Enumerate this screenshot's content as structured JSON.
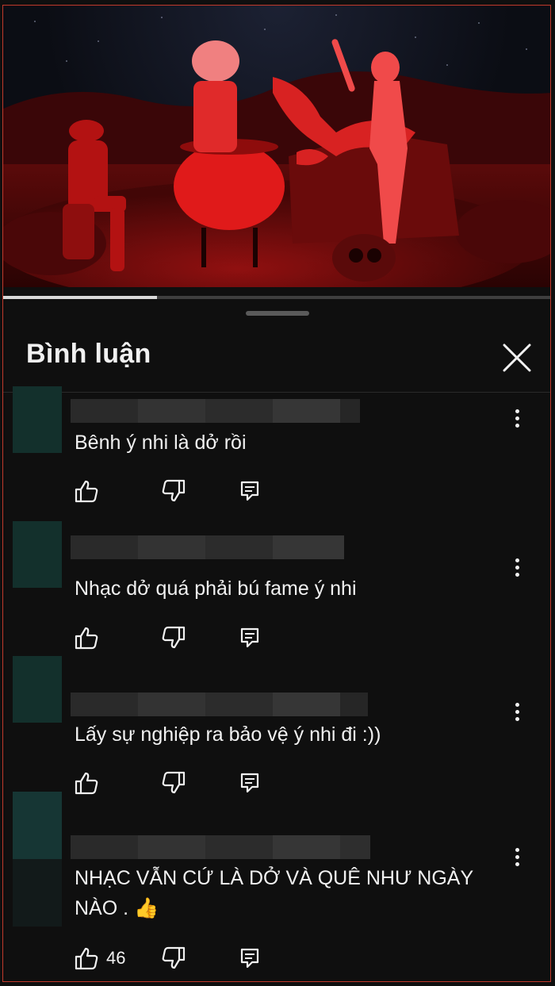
{
  "panel": {
    "title": "Bình luận"
  },
  "video": {
    "progress": 0.28
  },
  "comments": [
    {
      "text": "Bênh ý nhi là dở rồi",
      "like_count": ""
    },
    {
      "text": "Nhạc dở quá phải bú fame ý nhi",
      "like_count": ""
    },
    {
      "text": "Lấy sự nghiệp ra bảo vệ ý nhi đi :))",
      "like_count": ""
    },
    {
      "text": "NHẠC VẪN CỨ LÀ DỞ VÀ QUÊ NHƯ NGÀY NÀO . 👍",
      "like_count": "46"
    }
  ],
  "colors": {
    "accent_frame": "#c0392b",
    "background": "#0f0f0f",
    "text": "#f1f1f1"
  },
  "icons": [
    "close-icon",
    "like-icon",
    "dislike-icon",
    "reply-icon",
    "more-vert-icon"
  ]
}
